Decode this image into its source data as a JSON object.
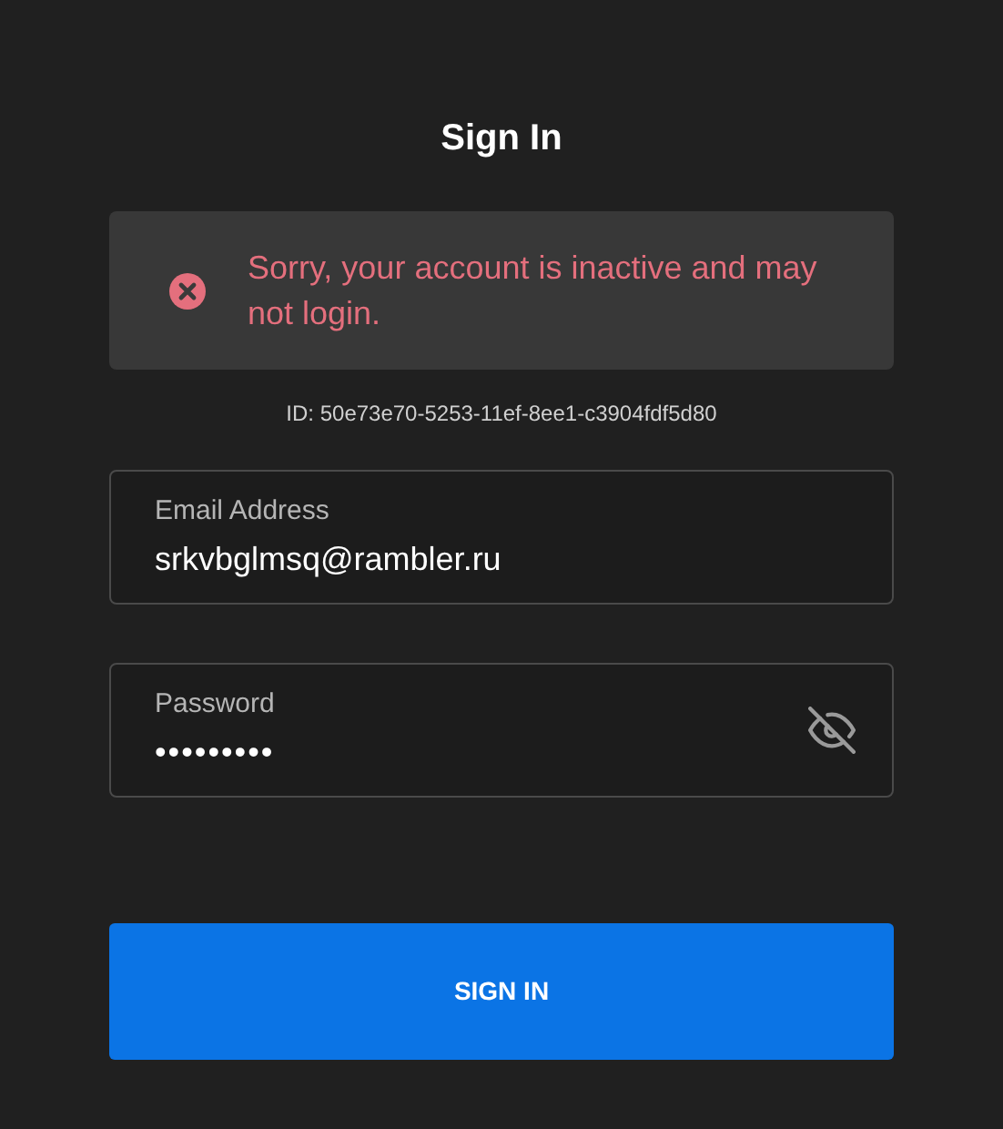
{
  "title": "Sign In",
  "error": {
    "message": "Sorry, your account is inactive and may not login."
  },
  "error_id": "ID: 50e73e70-5253-11ef-8ee1-c3904fdf5d80",
  "fields": [
    {
      "kind": "text",
      "label": "Email Address",
      "value": "srkvbglmsq@rambler.ru"
    },
    {
      "kind": "password",
      "label": "Password",
      "value": "•••••••••"
    }
  ],
  "button": "SIGN IN"
}
